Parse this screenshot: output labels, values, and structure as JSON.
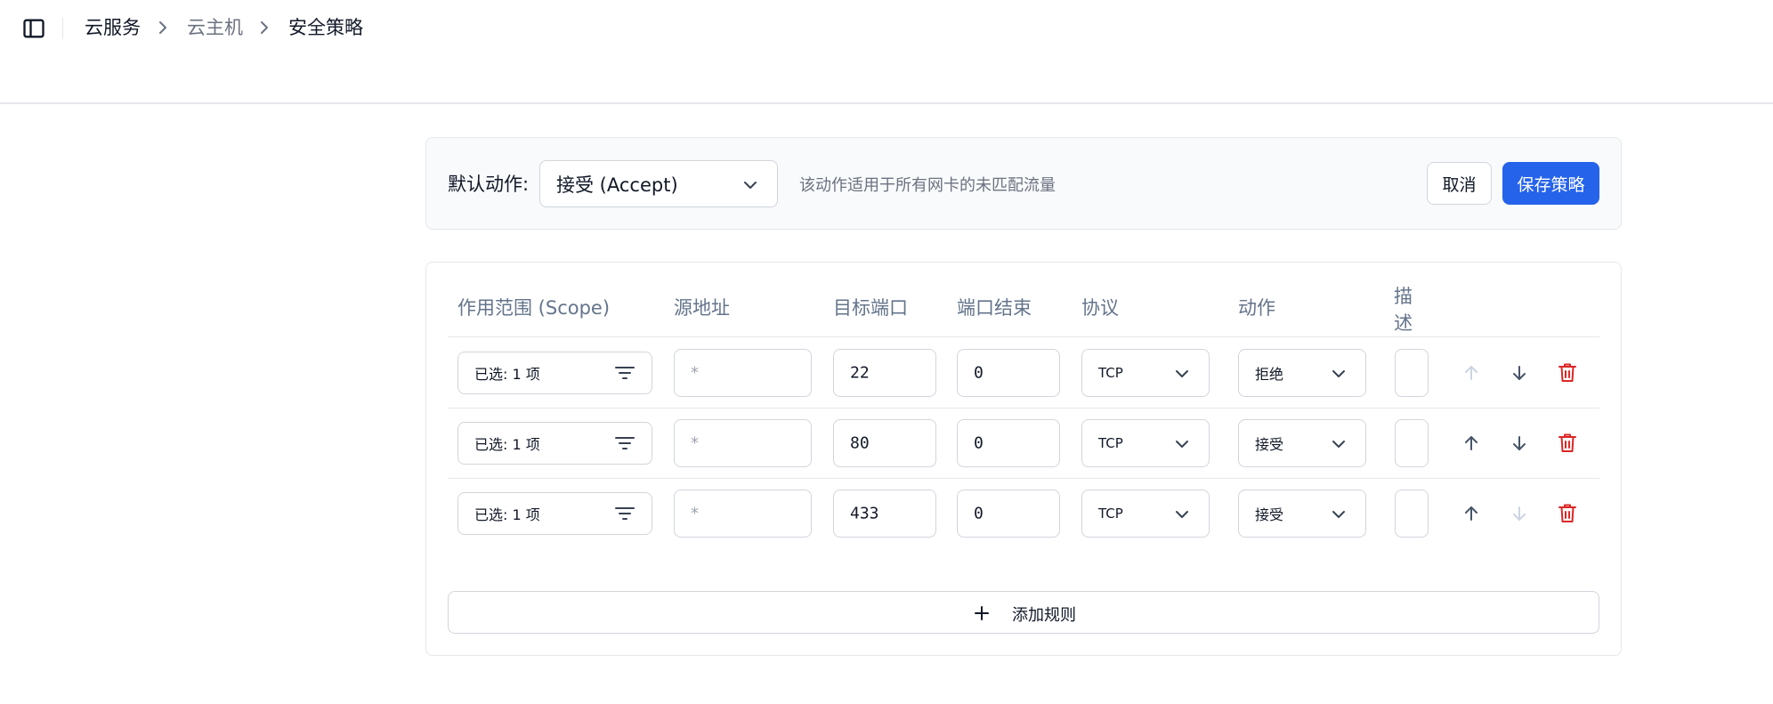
{
  "breadcrumb": {
    "items": [
      "云服务",
      "云主机",
      "安全策略"
    ]
  },
  "policy": {
    "default_action_label": "默认动作:",
    "default_action_value": "接受 (Accept)",
    "hint": "该动作适用于所有网卡的未匹配流量",
    "cancel_label": "取消",
    "save_label": "保存策略"
  },
  "table": {
    "columns": [
      "作用范围 (Scope)",
      "源地址",
      "目标端口",
      "端口结束",
      "协议",
      "动作",
      "描述"
    ],
    "rows": [
      {
        "scope": "已选: 1 项",
        "source_placeholder": "*",
        "port": "22",
        "port_end": "0",
        "protocol": "TCP",
        "action": "拒绝",
        "description": "",
        "up_enabled": false,
        "down_enabled": true
      },
      {
        "scope": "已选: 1 项",
        "source_placeholder": "*",
        "port": "80",
        "port_end": "0",
        "protocol": "TCP",
        "action": "接受",
        "description": "",
        "up_enabled": true,
        "down_enabled": true
      },
      {
        "scope": "已选: 1 项",
        "source_placeholder": "*",
        "port": "433",
        "port_end": "0",
        "protocol": "TCP",
        "action": "接受",
        "description": "",
        "up_enabled": true,
        "down_enabled": false
      }
    ],
    "add_rule_label": "添加规则"
  },
  "colors": {
    "primary": "#2563eb",
    "danger": "#dc2626",
    "icon_active": "#475569",
    "icon_disabled": "#cbd5e1",
    "header_text": "#64748b"
  },
  "icons": {
    "sidebar_toggle": "sidebar-toggle-icon",
    "breadcrumb_sep": "chevron-right-icon",
    "select": "chevron-down-icon",
    "scope_filter": "filter-icon",
    "move_up": "arrow-up-icon",
    "move_down": "arrow-down-icon",
    "delete": "trash-icon",
    "add": "plus-icon"
  }
}
